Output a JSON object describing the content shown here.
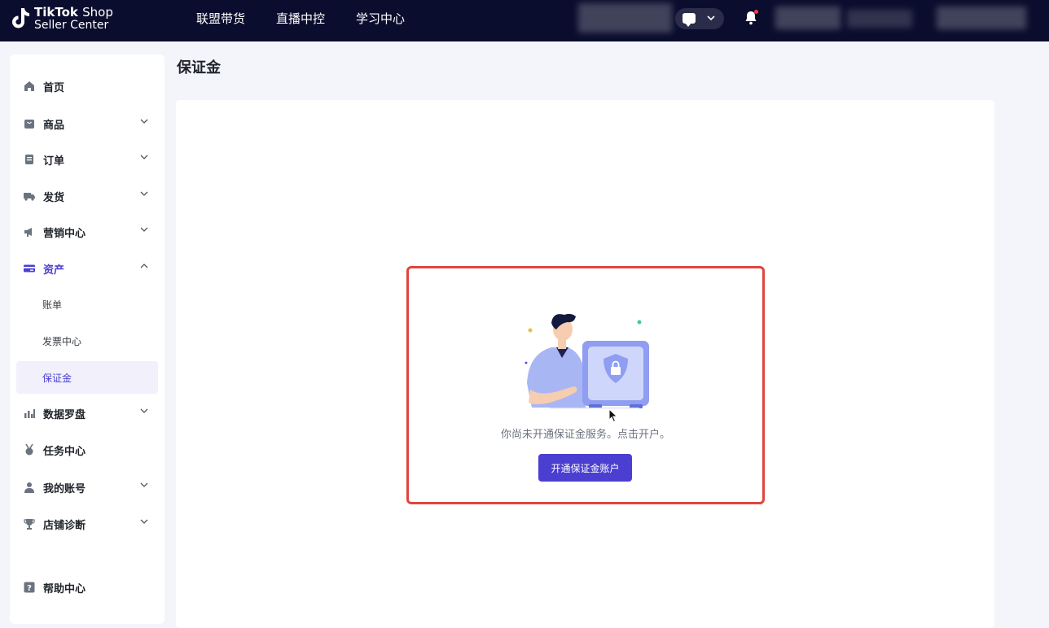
{
  "brand": {
    "name": "TikTok",
    "shop": "Shop",
    "sub": "Seller Center"
  },
  "topnav": [
    {
      "label": "联盟带货"
    },
    {
      "label": "直播中控"
    },
    {
      "label": "学习中心"
    }
  ],
  "sidebar": {
    "items": [
      {
        "label": "首页",
        "icon": "home-icon"
      },
      {
        "label": "商品",
        "icon": "product-icon"
      },
      {
        "label": "订单",
        "icon": "order-icon"
      },
      {
        "label": "发货",
        "icon": "truck-icon"
      },
      {
        "label": "营销中心",
        "icon": "megaphone-icon"
      },
      {
        "label": "资产",
        "icon": "card-icon"
      },
      {
        "label": "数据罗盘",
        "icon": "chart-icon"
      },
      {
        "label": "任务中心",
        "icon": "medal-icon"
      },
      {
        "label": "我的账号",
        "icon": "user-icon"
      },
      {
        "label": "店铺诊断",
        "icon": "trophy-icon"
      },
      {
        "label": "帮助中心",
        "icon": "help-icon"
      }
    ],
    "sub_items": [
      {
        "label": "账单"
      },
      {
        "label": "发票中心"
      },
      {
        "label": "保证金"
      }
    ]
  },
  "page": {
    "title": "保证金",
    "empty_text": "你尚未开通保证金服务。点击开户。",
    "open_button": "开通保证金账户"
  },
  "colors": {
    "topbar": "#0b0d2e",
    "accent": "#4b3fd1",
    "highlight": "#e0453e"
  }
}
